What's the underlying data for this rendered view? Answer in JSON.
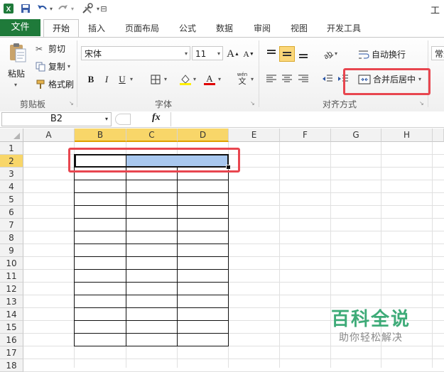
{
  "titlebar": {
    "title_fragment": "工作"
  },
  "tabs": [
    "文件",
    "开始",
    "插入",
    "页面布局",
    "公式",
    "数据",
    "审阅",
    "视图",
    "开发工具"
  ],
  "ribbon": {
    "clipboard": {
      "paste": "粘贴",
      "cut": "剪切",
      "copy": "复制",
      "format_painter": "格式刷",
      "label": "剪贴板"
    },
    "font": {
      "font_name": "宋体",
      "font_size": "11",
      "bold": "B",
      "italic": "I",
      "underline": "U",
      "label": "字体",
      "grow": "A",
      "shrink": "A"
    },
    "alignment": {
      "wrap_text": "自动换行",
      "merge_center": "合并后居中",
      "label": "对齐方式"
    },
    "number": {
      "format": "常规"
    }
  },
  "formula_bar": {
    "name_box": "B2",
    "fx": "fx",
    "content": ""
  },
  "columns": [
    "A",
    "B",
    "C",
    "D",
    "E",
    "F",
    "G",
    "H"
  ],
  "rows": [
    "1",
    "2",
    "3",
    "4",
    "5",
    "6",
    "7",
    "8",
    "9",
    "10",
    "11",
    "12",
    "13",
    "14",
    "15",
    "16",
    "17",
    "18"
  ],
  "watermark": {
    "title": "百科全说",
    "subtitle": "助你轻松解决"
  },
  "colors": {
    "file_tab": "#1f7a3a",
    "selection_header": "#f8d669",
    "highlight_red": "#e8464f",
    "selected_cells": "#a9c8ef"
  }
}
